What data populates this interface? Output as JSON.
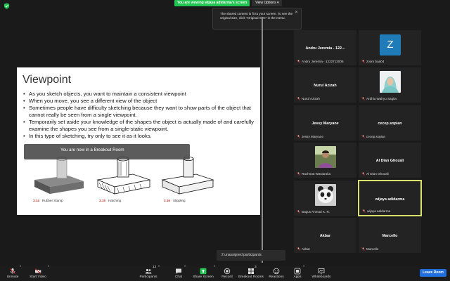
{
  "colors": {
    "accent_green": "#23c552",
    "active_speaker": "#d8e26d",
    "leave_blue": "#1f6fde",
    "avatar_blue": "#1f7cb8"
  },
  "share_banner": {
    "text": "You are viewing wijaya adidarma's screen",
    "view_options": "View Options"
  },
  "tooltip": {
    "text": "The shared content is fit to your screen. To see the original size, click \"Original Size\" in the menu."
  },
  "slide": {
    "title": "Viewpoint",
    "bullets": [
      "As you sketch objects, you want to maintain a consistent viewpoint",
      "When you move, you see a different view of the object",
      "Sometimes people have difficulty sketching because they want to show parts of the object that cannot really be seen from a single viewpoint.",
      "Temporarily set aside your knowledge of the shapes the object is actually made of and carefully examine the shapes you see from a single-static viewpoint.",
      "In this type of sketching, try only to see it as it looks."
    ],
    "figures": [
      {
        "num": "3.14",
        "label": "Rubber Stamp"
      },
      {
        "num": "3.15",
        "label": "Hatching"
      },
      {
        "num": "3.16",
        "label": "Stippling"
      }
    ]
  },
  "breakout_banner": "You are now in a Breakout Room",
  "participants": [
    {
      "name": "Andru Jeremia - 1222713006",
      "footer": "Andru Jeremia - 1222713006",
      "center": "Andru Jeremia - 122...",
      "kind": "name"
    },
    {
      "name": "zoom baa04",
      "footer": "zoom baa04",
      "center": "Z",
      "kind": "avatar"
    },
    {
      "name": "Nurul Azizah",
      "footer": "Nurul Azizah",
      "center": "Nurul Azizah",
      "kind": "name"
    },
    {
      "name": "Ardhia Wahyu Sagita",
      "footer": "Ardhia Wahyu Sagita",
      "center": "",
      "kind": "photo-hijab"
    },
    {
      "name": "Jessy Maryane",
      "footer": "Jessy Maryane",
      "center": "Jessy Maryane",
      "kind": "name"
    },
    {
      "name": "cecep.sopian",
      "footer": "cecep.sopian",
      "center": "cecep.sopian",
      "kind": "name"
    },
    {
      "name": "Rachmat Wasiaraka",
      "footer": "Rachmat Wasiaraka",
      "center": "",
      "kind": "photo-person"
    },
    {
      "name": "Al Dian Ghozali",
      "footer": "Al Dian Ghozali",
      "center": "Al Dian Ghozali",
      "kind": "name"
    },
    {
      "name": "Bagus Ahmad K. R.",
      "footer": "Bagus Ahmad K. R.",
      "center": "",
      "kind": "photo-panda"
    },
    {
      "name": "wijaya adidarma",
      "footer": "wijaya adidarma",
      "center": "wijaya adidarma",
      "kind": "name",
      "active": true
    },
    {
      "name": "Akbar",
      "footer": "Akbar",
      "center": "Akbar",
      "kind": "name"
    },
    {
      "name": "Marcello",
      "footer": "Marcello",
      "center": "Marcello",
      "kind": "name"
    }
  ],
  "unassigned": "2 unassigned participants",
  "toolbar": {
    "unmute": "Unmute",
    "start_video": "Start Video",
    "participants": "Participants",
    "participants_count": "12",
    "chat": "Chat",
    "share_screen": "Share Screen",
    "record": "Record",
    "breakout_rooms": "Breakout Rooms",
    "breakout_badge": "3",
    "reactions": "Reactions",
    "apps": "Apps",
    "whiteboards": "Whiteboards",
    "leave_room": "Leave Room"
  }
}
